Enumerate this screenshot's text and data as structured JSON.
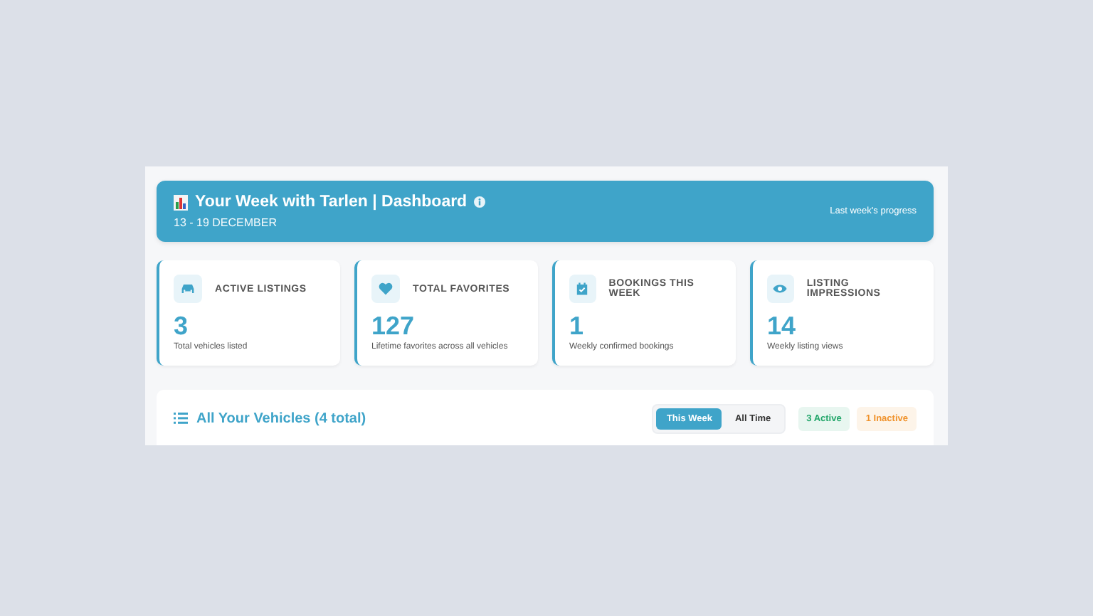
{
  "header": {
    "title": "Your Week with Tarlen | Dashboard",
    "date_range": "13 - 19 DECEMBER",
    "note": "Last week's progress"
  },
  "stats": [
    {
      "kind": "car",
      "label": "ACTIVE LISTINGS",
      "value": "3",
      "caption": "Total vehicles listed"
    },
    {
      "kind": "heart",
      "label": "TOTAL FAVORITES",
      "value": "127",
      "caption": "Lifetime favorites across all vehicles"
    },
    {
      "kind": "calendar",
      "label": "BOOKINGS THIS WEEK",
      "value": "1",
      "caption": "Weekly confirmed bookings"
    },
    {
      "kind": "eye",
      "label": "LISTING IMPRESSIONS",
      "value": "14",
      "caption": "Weekly listing views"
    }
  ],
  "vehicles": {
    "title": "All Your Vehicles (4 total)",
    "tabs": [
      {
        "label": "This Week",
        "selected": true
      },
      {
        "label": "All Time",
        "selected": false
      }
    ],
    "badges": [
      {
        "label": "3 Active",
        "color": "#22a66a"
      },
      {
        "label": "1 Inactive",
        "color": "#f0922b"
      }
    ]
  }
}
